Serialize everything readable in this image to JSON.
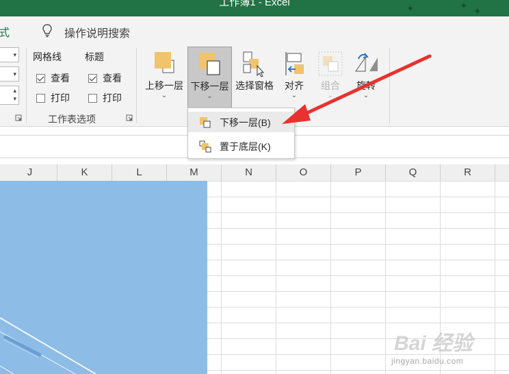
{
  "window": {
    "title": "工作簿1 - Excel"
  },
  "tabs": {
    "current_partial": "式"
  },
  "tell_me": {
    "label": "操作说明搜索"
  },
  "ribbon": {
    "sheet_options": {
      "gridlines_header": "网格线",
      "headings_header": "标题",
      "gridlines_view": {
        "label": "查看",
        "checked": true
      },
      "gridlines_print": {
        "label": "打印",
        "checked": false
      },
      "headings_view": {
        "label": "查看",
        "checked": true
      },
      "headings_print": {
        "label": "打印",
        "checked": false
      },
      "group_label": "工作表选项"
    },
    "arrange": {
      "bring_forward": "上移一层",
      "send_backward": "下移一层",
      "selection_pane": "选择窗格",
      "align": "对齐",
      "group": "组合",
      "rotate": "旋转"
    }
  },
  "dropdown": {
    "items": [
      {
        "label": "下移一层(B)",
        "icon": "send-backward-icon"
      },
      {
        "label": "置于底层(K)",
        "icon": "send-to-back-icon"
      }
    ]
  },
  "columns": [
    "J",
    "K",
    "L",
    "M",
    "N",
    "O",
    "P",
    "Q",
    "R"
  ],
  "shape": {
    "fill": "#8dbce6"
  },
  "annotation": {
    "arrow_color": "#e8322f"
  },
  "watermark": {
    "text": "Bai 经验",
    "url": "jingyan.baidu.com"
  }
}
